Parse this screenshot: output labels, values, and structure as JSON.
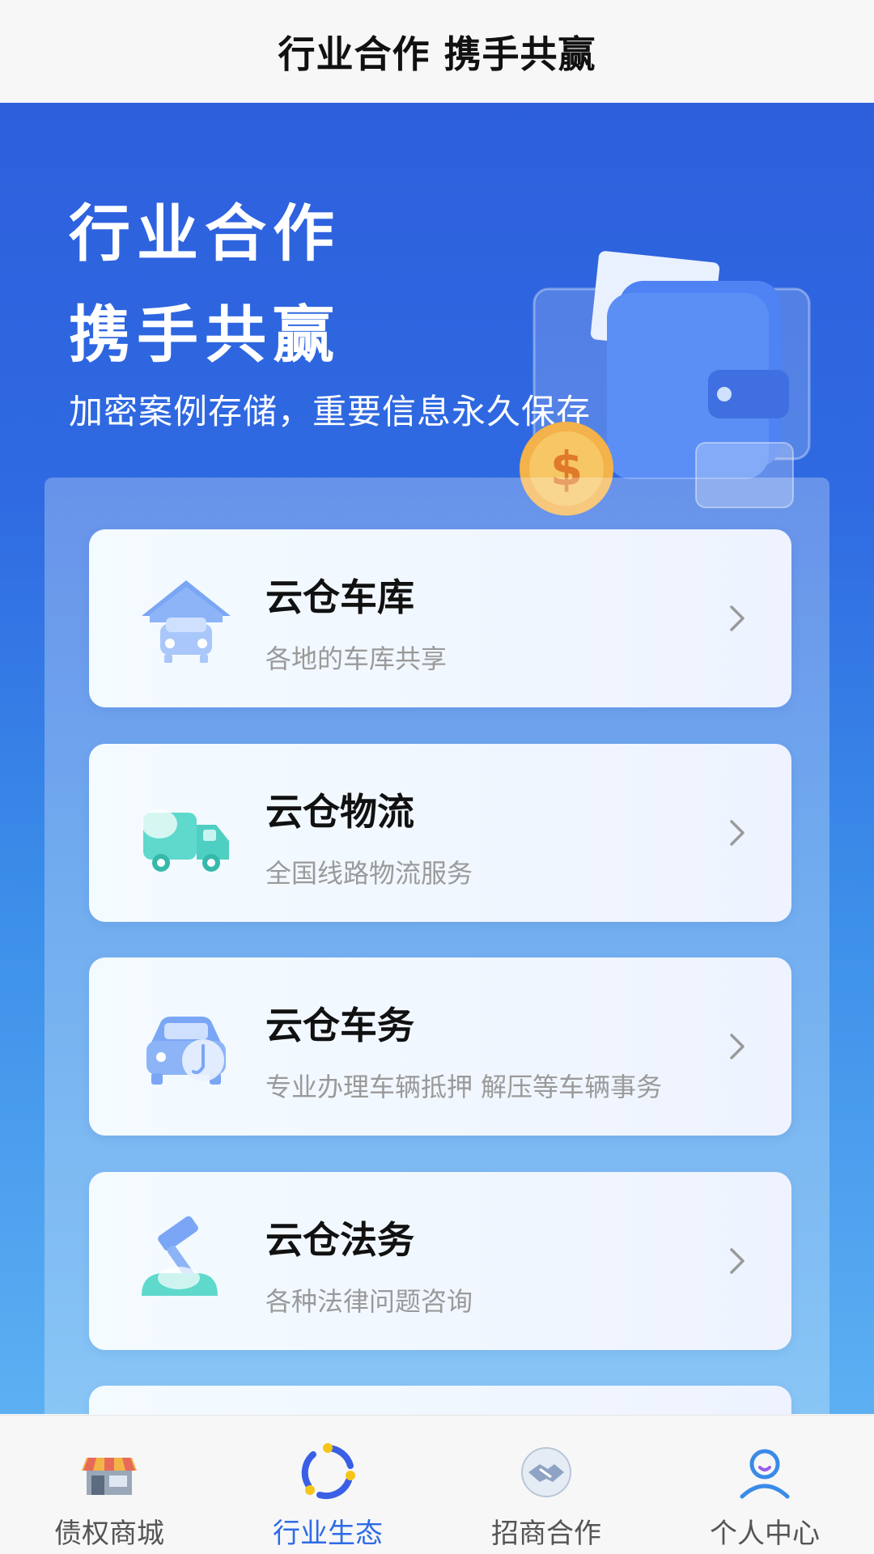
{
  "nav": {
    "title": "行业合作 携手共赢"
  },
  "hero": {
    "title_line1": "行业合作",
    "title_line2": "携手共赢",
    "subtitle": "加密案例存储，重要信息永久保存",
    "illustration": "wallet-coin-icon"
  },
  "cards": [
    {
      "title": "云仓车库",
      "desc": "各地的车库共享",
      "icon": "garage-icon"
    },
    {
      "title": "云仓物流",
      "desc": "全国线路物流服务",
      "icon": "truck-icon"
    },
    {
      "title": "云仓车务",
      "desc": "专业办理车辆抵押 解压等车辆事务",
      "icon": "car-service-icon"
    },
    {
      "title": "云仓法务",
      "desc": "各种法律问题咨询",
      "icon": "gavel-icon"
    }
  ],
  "tabs": [
    {
      "label": "债权商城",
      "icon": "store-icon",
      "active": false
    },
    {
      "label": "行业生态",
      "icon": "ecosystem-icon",
      "active": true
    },
    {
      "label": "招商合作",
      "icon": "handshake-icon",
      "active": false
    },
    {
      "label": "个人中心",
      "icon": "user-icon",
      "active": false
    }
  ],
  "colors": {
    "accent": "#2e6be6",
    "hero_top": "#2d5fdc",
    "hero_bottom": "#5cb0f2"
  }
}
